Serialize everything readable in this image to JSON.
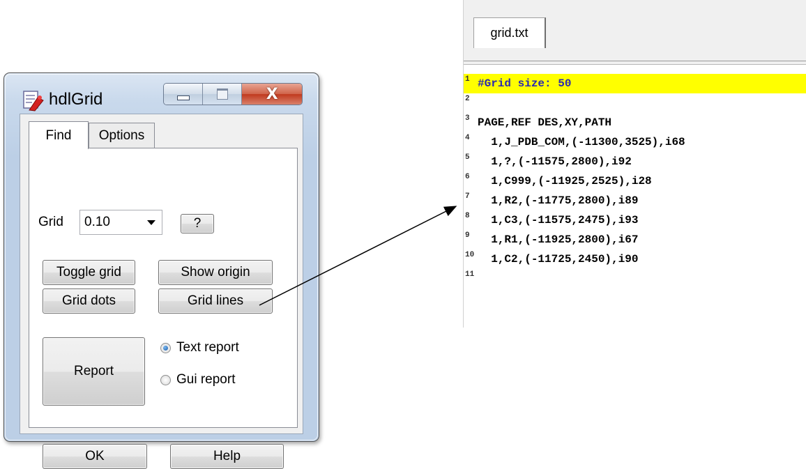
{
  "dialog": {
    "title": "hdlGrid",
    "icon": "hdlgrid-app-icon",
    "caption_buttons": {
      "minimize": "minimize-icon",
      "maximize": "maximize-icon",
      "close_glyph": "X"
    },
    "tabs": [
      {
        "label": "Find",
        "active": true
      },
      {
        "label": "Options",
        "active": false
      }
    ],
    "grid_label": "Grid",
    "grid_value": "0.10",
    "help_small_label": "?",
    "toggle_grid_label": "Toggle grid",
    "show_origin_label": "Show origin",
    "grid_dots_label": "Grid dots",
    "grid_lines_label": "Grid lines",
    "report_label": "Report",
    "radio_options": [
      {
        "label": "Text report",
        "checked": true
      },
      {
        "label": "Gui report",
        "checked": false
      }
    ],
    "ok_label": "OK",
    "help_label": "Help"
  },
  "editor": {
    "tab_label": "grid.txt",
    "lines": [
      {
        "num": "1",
        "text": "#Grid size: 50",
        "highlight": true
      },
      {
        "num": "2",
        "text": "",
        "highlight": false
      },
      {
        "num": "3",
        "text": "PAGE,REF DES,XY,PATH",
        "highlight": false
      },
      {
        "num": "4",
        "text": "  1,J_PDB_COM,(-11300,3525),i68",
        "highlight": false
      },
      {
        "num": "5",
        "text": "  1,?,(-11575,2800),i92",
        "highlight": false
      },
      {
        "num": "6",
        "text": "  1,C999,(-11925,2525),i28",
        "highlight": false
      },
      {
        "num": "7",
        "text": "  1,R2,(-11775,2800),i89",
        "highlight": false
      },
      {
        "num": "8",
        "text": "  1,C3,(-11575,2475),i93",
        "highlight": false
      },
      {
        "num": "9",
        "text": "  1,R1,(-11925,2800),i67",
        "highlight": false
      },
      {
        "num": "10",
        "text": "  1,C2,(-11725,2450),i90",
        "highlight": false
      },
      {
        "num": "11",
        "text": "",
        "highlight": false
      }
    ],
    "highlight_color": "#ffff00"
  }
}
